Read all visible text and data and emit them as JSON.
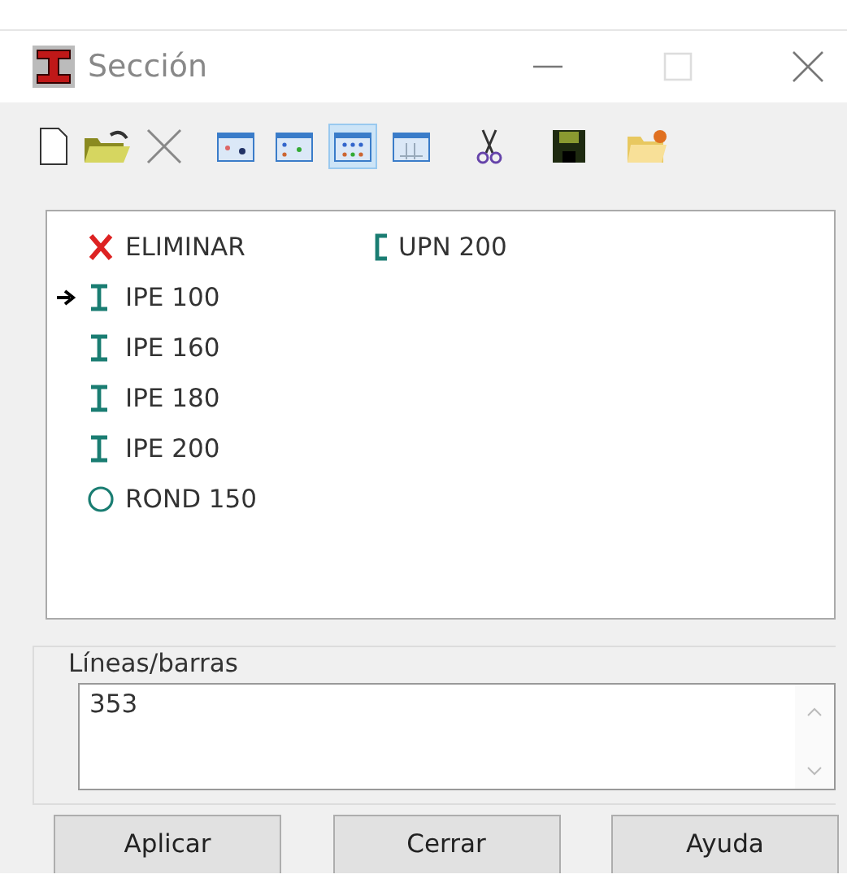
{
  "window": {
    "title": "Sección"
  },
  "toolbar": {
    "view_modes": [
      {
        "selected": false
      },
      {
        "selected": false
      },
      {
        "selected": true
      },
      {
        "selected": false
      }
    ]
  },
  "sections": [
    {
      "label": "ELIMINAR",
      "kind": "delete",
      "selected": false
    },
    {
      "label": "IPE 100",
      "kind": "ibeam",
      "selected": true
    },
    {
      "label": "IPE 160",
      "kind": "ibeam",
      "selected": false
    },
    {
      "label": "IPE 180",
      "kind": "ibeam",
      "selected": false
    },
    {
      "label": "IPE 200",
      "kind": "ibeam",
      "selected": false
    },
    {
      "label": "ROND 150",
      "kind": "round",
      "selected": false
    },
    {
      "label": "UPN 200",
      "kind": "channel",
      "selected": false
    }
  ],
  "lines_group": {
    "label": "Líneas/barras",
    "value": "353"
  },
  "buttons": [
    "Aplicar",
    "Cerrar",
    "Ayuda"
  ]
}
